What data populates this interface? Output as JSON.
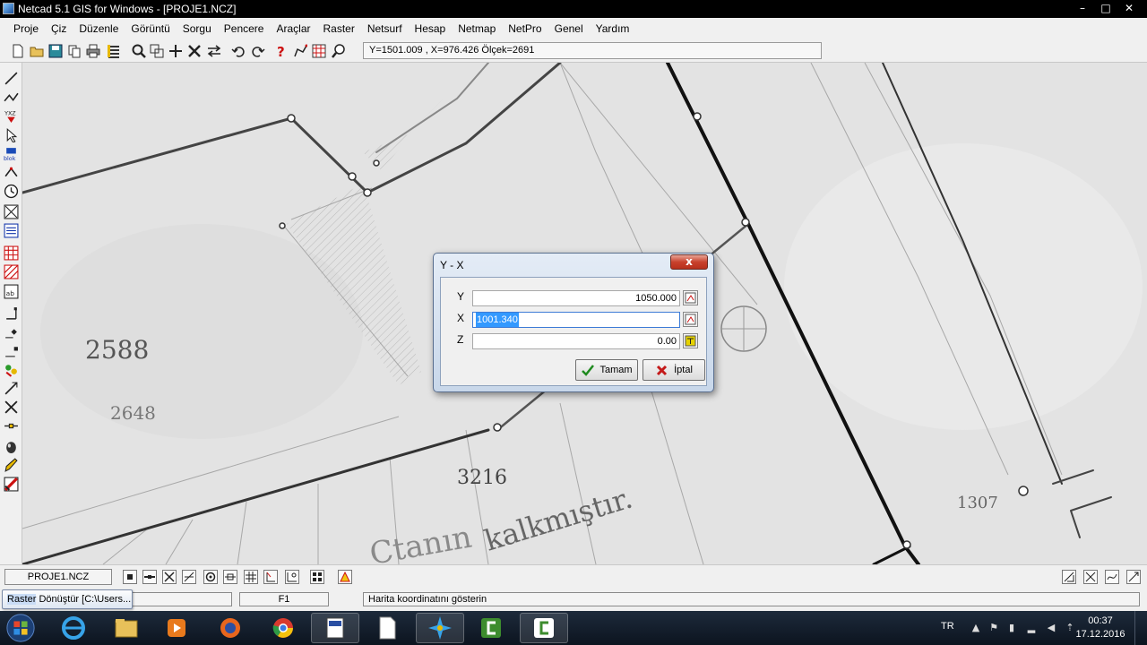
{
  "window": {
    "title": "Netcad 5.1 GIS for Windows - [PROJE1.NCZ]"
  },
  "menu": [
    "Proje",
    "Çiz",
    "Düzenle",
    "Görüntü",
    "Sorgu",
    "Pencere",
    "Araçlar",
    "Raster",
    "Netsurf",
    "Hesap",
    "Netmap",
    "NetPro",
    "Genel",
    "Yardım"
  ],
  "toolbar": {
    "coords": "Y=1501.009 , X=976.426 Ölçek=2691"
  },
  "map": {
    "labels": [
      "2588",
      "2648",
      "3216",
      "1307",
      "Ctanın",
      "kalkmıştır."
    ]
  },
  "dialog": {
    "title": "Y - X",
    "close_label": "x",
    "fields": [
      {
        "label": "Y",
        "value": "1050.000"
      },
      {
        "label": "X",
        "value": "1001.340"
      },
      {
        "label": "Z",
        "value": "0.00"
      }
    ],
    "ok_label": "Tamam",
    "cancel_label": "İptal"
  },
  "layerbar": {
    "layer": "PROJE1.NCZ"
  },
  "statusbar": {
    "key": "F1",
    "message": "Harita koordinatını gösterin"
  },
  "tooltip": {
    "highlight": "Raster",
    "rest": " Dönüştür [C:\\Users..."
  },
  "tray": {
    "language": "TR",
    "time": "00:37",
    "date": "17.12.2016"
  },
  "colors": {
    "selection": "#3399ff",
    "close_button": "#c8412c",
    "taskbar": "#14202e"
  }
}
